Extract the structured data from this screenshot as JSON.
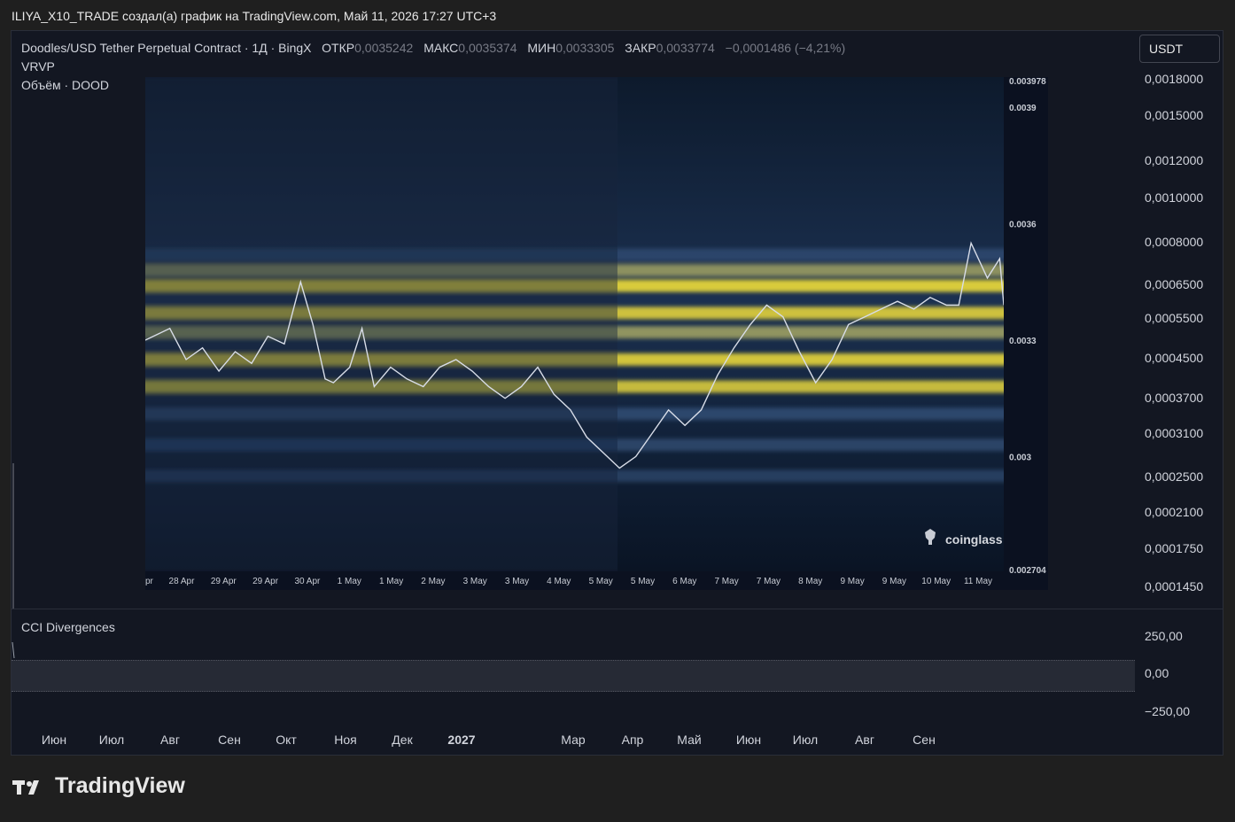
{
  "header": {
    "text": "ILIYA_X10_TRADE создал(а) график на TradingView.com, Май 11, 2026 17:27 UTC+3"
  },
  "legend": {
    "symbol": "Doodles/USD Tether Perpetual Contract · 1Д · BingX",
    "open_label": "ОТКР",
    "open_value": "0,0035242",
    "high_label": "МАКС",
    "high_value": "0,0035374",
    "low_label": "МИН",
    "low_value": "0,0033305",
    "close_label": "ЗАКР",
    "close_value": "0,0033774",
    "change": "−0,0001486 (−4,21%)"
  },
  "indicators": {
    "vrvp": "VRVP",
    "volume": "Объём · DOOD",
    "cci": "CCI Divergences"
  },
  "currency_button": "USDT",
  "price_scale": [
    "0,0018000",
    "0,0015000",
    "0,0012000",
    "0,0010000",
    "0,0008000",
    "0,0006500",
    "0,0005500",
    "0,0004500",
    "0,0003700",
    "0,0003100",
    "0,0002500",
    "0,0002100",
    "0,0001750",
    "0,0001450"
  ],
  "cci_scale": [
    "250,00",
    "0,00",
    "−250,00"
  ],
  "time_axis": [
    {
      "label": "Июн",
      "bold": false
    },
    {
      "label": "Июл",
      "bold": false
    },
    {
      "label": "Авг",
      "bold": false
    },
    {
      "label": "Сен",
      "bold": false
    },
    {
      "label": "Окт",
      "bold": false
    },
    {
      "label": "Ноя",
      "bold": false
    },
    {
      "label": "Дек",
      "bold": false
    },
    {
      "label": "2027",
      "bold": true
    },
    {
      "label": "Мар",
      "bold": false
    },
    {
      "label": "Апр",
      "bold": false
    },
    {
      "label": "Май",
      "bold": false
    },
    {
      "label": "Июн",
      "bold": false
    },
    {
      "label": "Июл",
      "bold": false
    },
    {
      "label": "Авг",
      "bold": false
    },
    {
      "label": "Сен",
      "bold": false
    }
  ],
  "footer": {
    "brand": "TradingView"
  },
  "colors": {
    "background": "#131722",
    "heat_low": "#0b1424",
    "heat_mid": "#3a5a86",
    "heat_high": "#f5e23a",
    "price_line": "#d8dde8"
  },
  "chart_data": {
    "type": "heatmap",
    "title": "",
    "watermark": "coinglass",
    "x_labels": [
      "pr",
      "28 Apr",
      "29 Apr",
      "29 Apr",
      "30 Apr",
      "1 May",
      "1 May",
      "2 May",
      "3 May",
      "3 May",
      "4 May",
      "5 May",
      "5 May",
      "6 May",
      "7 May",
      "7 May",
      "8 May",
      "9 May",
      "9 May",
      "10 May",
      "11 May"
    ],
    "y_labels": [
      "0.003978",
      "0.0039",
      "0.0036",
      "0.0033",
      "0.003",
      "0.002704"
    ],
    "ylim": [
      0.002704,
      0.003978
    ],
    "price_series": [
      [
        0,
        0.0033
      ],
      [
        6,
        0.00333
      ],
      [
        10,
        0.00325
      ],
      [
        14,
        0.00328
      ],
      [
        18,
        0.00322
      ],
      [
        22,
        0.00327
      ],
      [
        26,
        0.00324
      ],
      [
        30,
        0.00331
      ],
      [
        34,
        0.00329
      ],
      [
        38,
        0.00345
      ],
      [
        41,
        0.00334
      ],
      [
        44,
        0.0032
      ],
      [
        46,
        0.00319
      ],
      [
        50,
        0.00323
      ],
      [
        53,
        0.00333
      ],
      [
        56,
        0.00318
      ],
      [
        60,
        0.00323
      ],
      [
        64,
        0.0032
      ],
      [
        68,
        0.00318
      ],
      [
        72,
        0.00323
      ],
      [
        76,
        0.00325
      ],
      [
        80,
        0.00322
      ],
      [
        84,
        0.00318
      ],
      [
        88,
        0.00315
      ],
      [
        92,
        0.00318
      ],
      [
        96,
        0.00323
      ],
      [
        100,
        0.00316
      ],
      [
        104,
        0.00312
      ],
      [
        108,
        0.00305
      ],
      [
        112,
        0.00301
      ],
      [
        116,
        0.00297
      ],
      [
        120,
        0.003
      ],
      [
        124,
        0.00306
      ],
      [
        128,
        0.00312
      ],
      [
        132,
        0.00308
      ],
      [
        136,
        0.00312
      ],
      [
        140,
        0.00321
      ],
      [
        144,
        0.00328
      ],
      [
        148,
        0.00334
      ],
      [
        152,
        0.00339
      ],
      [
        156,
        0.00336
      ],
      [
        160,
        0.00327
      ],
      [
        164,
        0.00319
      ],
      [
        168,
        0.00325
      ],
      [
        172,
        0.00334
      ],
      [
        176,
        0.00336
      ],
      [
        180,
        0.00338
      ],
      [
        184,
        0.0034
      ],
      [
        188,
        0.00338
      ],
      [
        192,
        0.00341
      ],
      [
        196,
        0.00339
      ],
      [
        199,
        0.00339
      ],
      [
        202,
        0.00355
      ],
      [
        206,
        0.00346
      ],
      [
        209,
        0.00351
      ],
      [
        210,
        0.00339
      ]
    ],
    "heat_bands": [
      {
        "price": 0.00344,
        "intensity": 0.95
      },
      {
        "price": 0.00337,
        "intensity": 0.85
      },
      {
        "price": 0.00332,
        "intensity": 0.6
      },
      {
        "price": 0.00325,
        "intensity": 0.9
      },
      {
        "price": 0.00318,
        "intensity": 0.8
      },
      {
        "price": 0.00311,
        "intensity": 0.5
      },
      {
        "price": 0.00348,
        "intensity": 0.55
      },
      {
        "price": 0.00352,
        "intensity": 0.35
      },
      {
        "price": 0.00303,
        "intensity": 0.45
      },
      {
        "price": 0.00295,
        "intensity": 0.3
      }
    ]
  }
}
